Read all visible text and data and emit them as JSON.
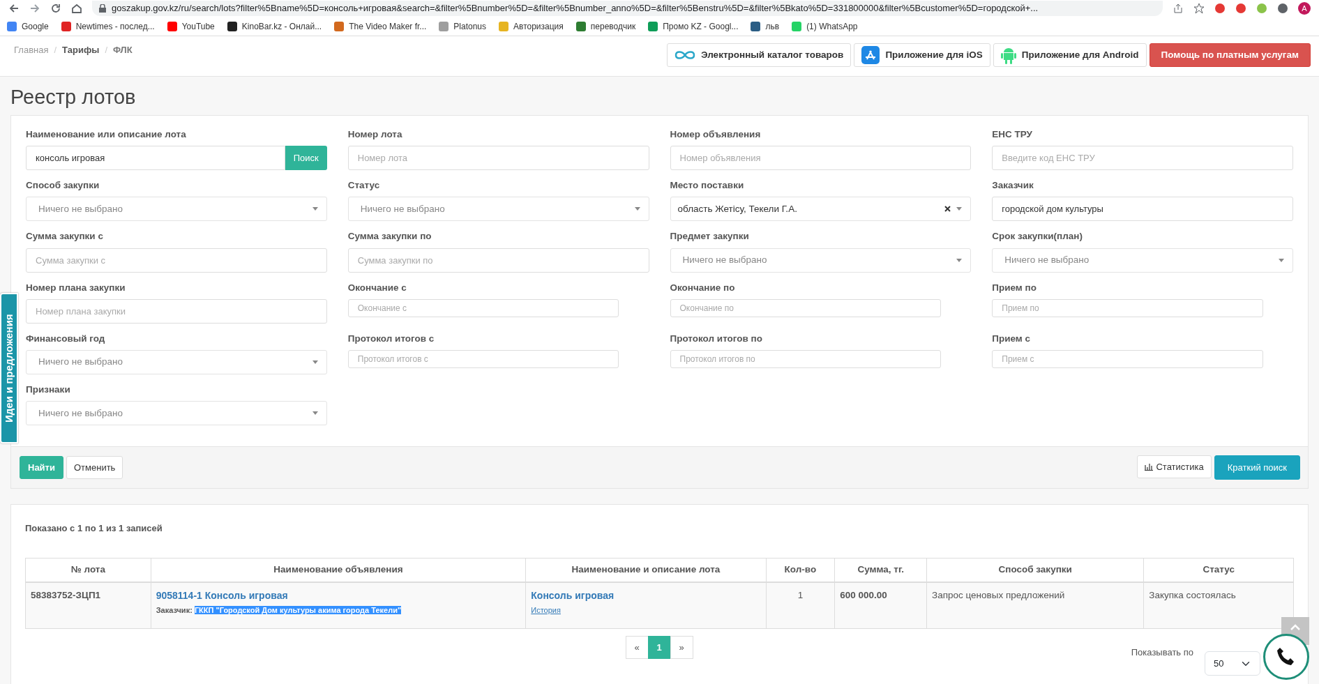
{
  "browser": {
    "url": "goszakup.gov.kz/ru/search/lots?filter%5Bname%5D=консоль+игровая&search=&filter%5Bnumber%5D=&filter%5Bnumber_anno%5D=&filter%5Benstru%5D=&filter%5Bkato%5D=331800000&filter%5Bcustomer%5D=городской+...",
    "profile": "A",
    "bookmarks": [
      {
        "label": "Google",
        "color": "#4285f4"
      },
      {
        "label": "Newtimes - послед...",
        "color": "#e02424"
      },
      {
        "label": "YouTube",
        "color": "#ff0000"
      },
      {
        "label": "KinoBar.kz - Онлай...",
        "color": "#222222"
      },
      {
        "label": "The Video Maker fr...",
        "color": "#d2691e"
      },
      {
        "label": "Platonus",
        "color": "#9e9e9e"
      },
      {
        "label": "Авторизация",
        "color": "#e6b422"
      },
      {
        "label": "переводчик",
        "color": "#2e7d32"
      },
      {
        "label": "Промо KZ - Googl...",
        "color": "#0f9d58"
      },
      {
        "label": "льв",
        "color": "#2a5d84"
      },
      {
        "label": "(1) WhatsApp",
        "color": "#25d366"
      }
    ]
  },
  "breadcrumb_separator": "/",
  "breadcrumb": [
    {
      "label": "Главная",
      "bold": false
    },
    {
      "label": "Тарифы",
      "bold": true
    },
    {
      "label": "ФЛК",
      "bold": true
    }
  ],
  "header_buttons": [
    {
      "label": "Электронный каталог товаров",
      "kind": "catalog"
    },
    {
      "label": "Приложение для iOS",
      "kind": "ios"
    },
    {
      "label": "Приложение для Android",
      "kind": "android"
    },
    {
      "label": "Помощь по платным услугам",
      "kind": "help"
    }
  ],
  "page_title": "Реестр лотов",
  "filters": [
    {
      "label": "Наименование или описание лота",
      "kind": "search",
      "value": "консоль игровая",
      "button": "Поиск"
    },
    {
      "label": "Номер лота",
      "kind": "text",
      "placeholder": "Номер лота"
    },
    {
      "label": "Номер объявления",
      "kind": "text",
      "placeholder": "Номер объявления"
    },
    {
      "label": "ЕНС ТРУ",
      "kind": "text",
      "placeholder": "Введите код ЕНС ТРУ"
    },
    {
      "label": "Способ закупки",
      "kind": "select",
      "placeholder": "Ничего не выбрано"
    },
    {
      "label": "Статус",
      "kind": "select",
      "placeholder": "Ничего не выбрано"
    },
    {
      "label": "Место поставки",
      "kind": "select-clear",
      "value": "область Жетісу, Текели Г.А."
    },
    {
      "label": "Заказчик",
      "kind": "text",
      "value": "городской дом культуры"
    },
    {
      "label": "Сумма закупки с",
      "kind": "text",
      "placeholder": "Сумма закупки с"
    },
    {
      "label": "Сумма закупки по",
      "kind": "text",
      "placeholder": "Сумма закупки по"
    },
    {
      "label": "Предмет закупки",
      "kind": "select",
      "placeholder": "Ничего не выбрано"
    },
    {
      "label": "Срок закупки(план)",
      "kind": "select",
      "placeholder": "Ничего не выбрано"
    },
    {
      "label": "Номер плана закупки",
      "kind": "text",
      "placeholder": "Номер плана закупки"
    },
    {
      "label": "Окончание с",
      "kind": "date",
      "placeholder": "Окончание с"
    },
    {
      "label": "Окончание по",
      "kind": "date",
      "placeholder": "Окончание по"
    },
    {
      "label": "Прием по",
      "kind": "date",
      "placeholder": "Прием по"
    },
    {
      "label": "Финансовый год",
      "kind": "select",
      "placeholder": "Ничего не выбрано"
    },
    {
      "label": "Протокол итогов с",
      "kind": "date",
      "placeholder": "Протокол итогов с"
    },
    {
      "label": "Протокол итогов по",
      "kind": "date",
      "placeholder": "Протокол итогов по"
    },
    {
      "label": "Прием с",
      "kind": "date",
      "placeholder": "Прием с"
    },
    {
      "label": "Признаки",
      "kind": "select",
      "placeholder": "Ничего не выбрано"
    }
  ],
  "actions_left": [
    {
      "label": "Найти",
      "kind": "primary"
    },
    {
      "label": "Отменить",
      "kind": "default"
    }
  ],
  "actions_right": [
    {
      "label": "Статистика",
      "kind": "stats"
    },
    {
      "label": "Краткий поиск",
      "kind": "info"
    }
  ],
  "side_tab": "Идеи и предложения",
  "results": {
    "summary": "Показано с 1 по 1 из 1 записей",
    "columns": [
      "№ лота",
      "Наименование объявления",
      "Наименование и описание лота",
      "Кол-во",
      "Сумма, тг.",
      "Способ закупки",
      "Статус"
    ],
    "rows": [
      {
        "lot_number": "58383752-ЗЦП1",
        "announcement": "9058114-1 Консоль игровая",
        "customer_label": "Заказчик:",
        "customer": "ГККП \"Городской Дом культуры акима города Текели\"",
        "customer_selected": true,
        "lot_name": "Консоль игровая",
        "history": "История",
        "quantity": "1",
        "sum": "600 000.00",
        "method": "Запрос ценовых предложений",
        "status": "Закупка состоялась"
      }
    ]
  },
  "pagination": [
    {
      "label": "«",
      "selected": false
    },
    {
      "label": "1",
      "selected": true
    },
    {
      "label": "»",
      "selected": false
    }
  ],
  "page_size": {
    "label": "Показывать по",
    "value": "50"
  }
}
